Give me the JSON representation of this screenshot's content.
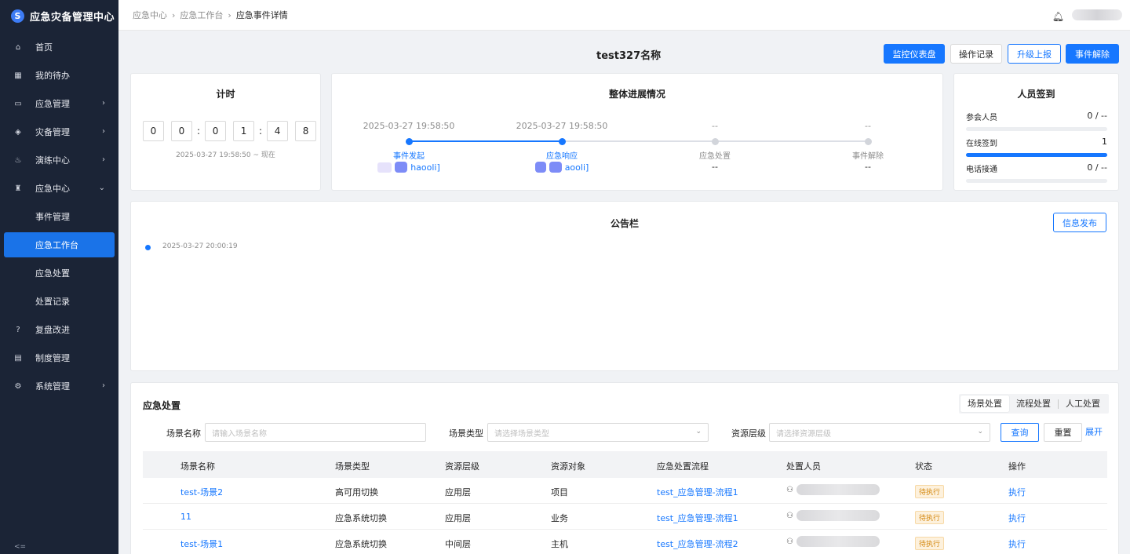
{
  "app": {
    "title": "应急灾备管理中心"
  },
  "sidebar": {
    "items": [
      {
        "label": "首页",
        "icon": "home-icon",
        "glyph": "⌂"
      },
      {
        "label": "我的待办",
        "icon": "calendar-icon",
        "glyph": "▦"
      },
      {
        "label": "应急管理",
        "icon": "monitor-icon",
        "glyph": "▭"
      },
      {
        "label": "灾备管理",
        "icon": "layers-icon",
        "glyph": "◈"
      },
      {
        "label": "演练中心",
        "icon": "drill-icon",
        "glyph": "♨"
      },
      {
        "label": "应急中心",
        "icon": "siren-icon",
        "glyph": "♜"
      },
      {
        "label": "事件管理"
      },
      {
        "label": "应急工作台"
      },
      {
        "label": "应急处置"
      },
      {
        "label": "处置记录"
      },
      {
        "label": "复盘改进",
        "icon": "help-circle-icon",
        "glyph": "?"
      },
      {
        "label": "制度管理",
        "icon": "book-icon",
        "glyph": "▤"
      },
      {
        "label": "系统管理",
        "icon": "settings-icon",
        "glyph": "⚙"
      }
    ]
  },
  "breadcrumb": {
    "items": [
      "应急中心",
      "应急工作台",
      "应急事件详情"
    ]
  },
  "header": {
    "event_title": "test327名称",
    "buttons": {
      "dashboard": "监控仪表盘",
      "log": "操作记录",
      "escalate": "升级上报",
      "resolve": "事件解除"
    }
  },
  "timer": {
    "title": "计时",
    "digits": [
      "0",
      "0",
      "0",
      "1",
      "4",
      "8"
    ],
    "range": "2025-03-27 19:58:50 ~ 现在"
  },
  "progress": {
    "title": "整体进展情况",
    "steps": [
      {
        "time": "2025-03-27 19:58:50",
        "name": "事件发起",
        "person": "haooli]",
        "state": "done"
      },
      {
        "time": "2025-03-27 19:58:50",
        "name": "应急响应",
        "person": "aooli]",
        "state": "done"
      },
      {
        "time": "--",
        "name": "应急处置",
        "person": "--",
        "state": "todo"
      },
      {
        "time": "--",
        "name": "事件解除",
        "person": "--",
        "state": "todo"
      }
    ]
  },
  "signin": {
    "title": "人员签到",
    "rows": [
      {
        "label": "参会人员",
        "value": "0 / --",
        "fill": 0
      },
      {
        "label": "在线签到",
        "value": "1",
        "fill": 1
      },
      {
        "label": "电话接通",
        "value": "0 / --",
        "fill": 0
      }
    ]
  },
  "notice": {
    "title": "公告栏",
    "publish": "信息发布",
    "items": [
      {
        "time": "2025-03-27 20:00:19"
      }
    ]
  },
  "emergency": {
    "title": "应急处置",
    "tabs": [
      "场景处置",
      "流程处置",
      "人工处置"
    ],
    "filters": {
      "name_label": "场景名称",
      "name_placeholder": "请输入场景名称",
      "type_label": "场景类型",
      "type_placeholder": "请选择场景类型",
      "level_label": "资源层级",
      "level_placeholder": "请选择资源层级"
    },
    "actions": {
      "query": "查询",
      "reset": "重置",
      "expand": "展开"
    },
    "columns": [
      "场景名称",
      "场景类型",
      "资源层级",
      "资源对象",
      "应急处置流程",
      "处置人员",
      "状态",
      "操作"
    ],
    "rows": [
      {
        "name": "test-场景2",
        "type": "高可用切换",
        "level": "应用层",
        "object": "项目",
        "flow": "test_应急管理-流程1",
        "status": "待执行",
        "op": "执行"
      },
      {
        "name": "11",
        "type": "应急系统切换",
        "level": "应用层",
        "object": "业务",
        "flow": "test_应急管理-流程1",
        "status": "待执行",
        "op": "执行"
      },
      {
        "name": "test-场景1",
        "type": "应急系统切换",
        "level": "中间层",
        "object": "主机",
        "flow": "test_应急管理-流程2",
        "status": "待执行",
        "op": "执行"
      }
    ]
  },
  "colors": {
    "sidebar_bg": "#1b2436",
    "primary": "#1677ff",
    "status_pending": "#d4880f"
  }
}
